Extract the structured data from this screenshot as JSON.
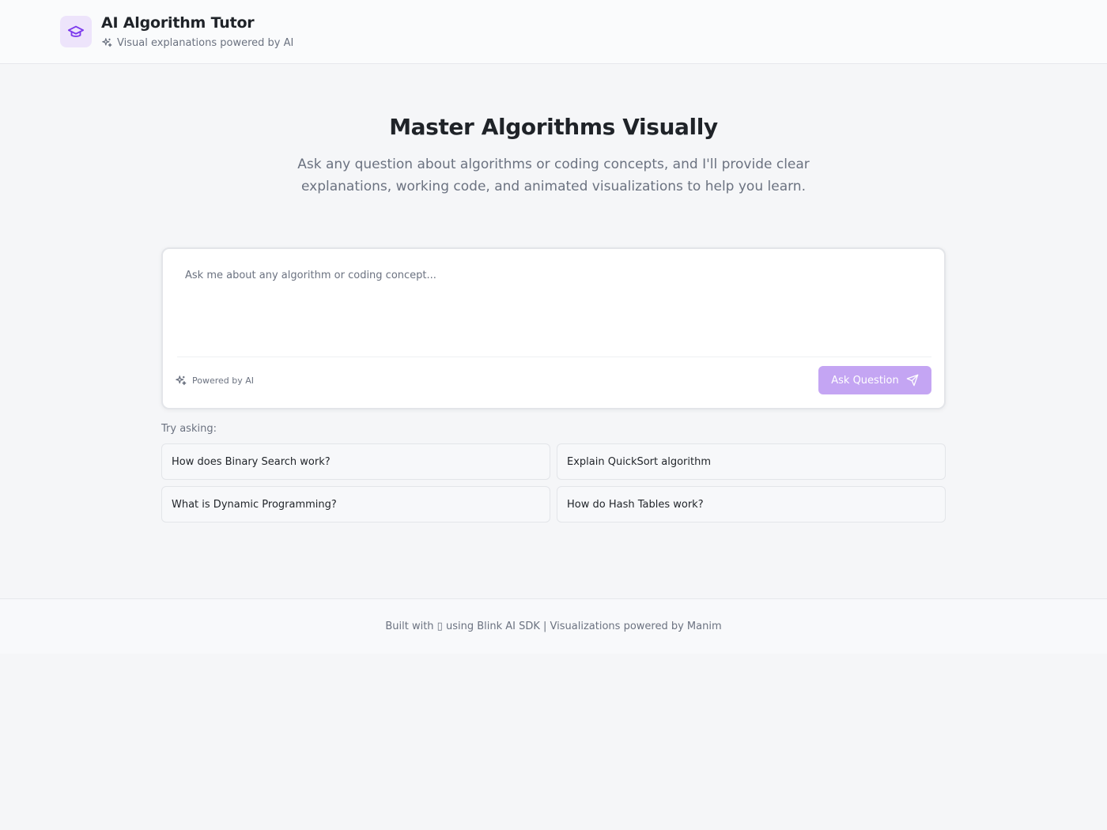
{
  "header": {
    "title": "AI Algorithm Tutor",
    "subtitle": "Visual explanations powered by AI",
    "logo_icon": "graduation-cap-icon",
    "subtitle_icon": "sparkles-icon"
  },
  "hero": {
    "title": "Master Algorithms Visually",
    "description": "Ask any question about algorithms or coding concepts, and I'll provide clear explanations, working code, and animated visualizations to help you learn."
  },
  "question": {
    "placeholder": "Ask me about any algorithm or coding concept...",
    "value": "",
    "powered_label": "Powered by AI",
    "submit_label": "Ask Question",
    "submit_icon": "send-icon"
  },
  "suggestions": {
    "label": "Try asking:",
    "items": [
      "How does Binary Search work?",
      "Explain QuickSort algorithm",
      "What is Dynamic Programming?",
      "How do Hash Tables work?"
    ]
  },
  "footer": {
    "text": "Built with ▯ using Blink AI SDK | Visualizations powered by Manim"
  },
  "colors": {
    "accent": "#7c3aed",
    "accent_light": "#ede4fb",
    "button_disabled": "#c4a5f3",
    "page_background": "#f5f6f8"
  }
}
